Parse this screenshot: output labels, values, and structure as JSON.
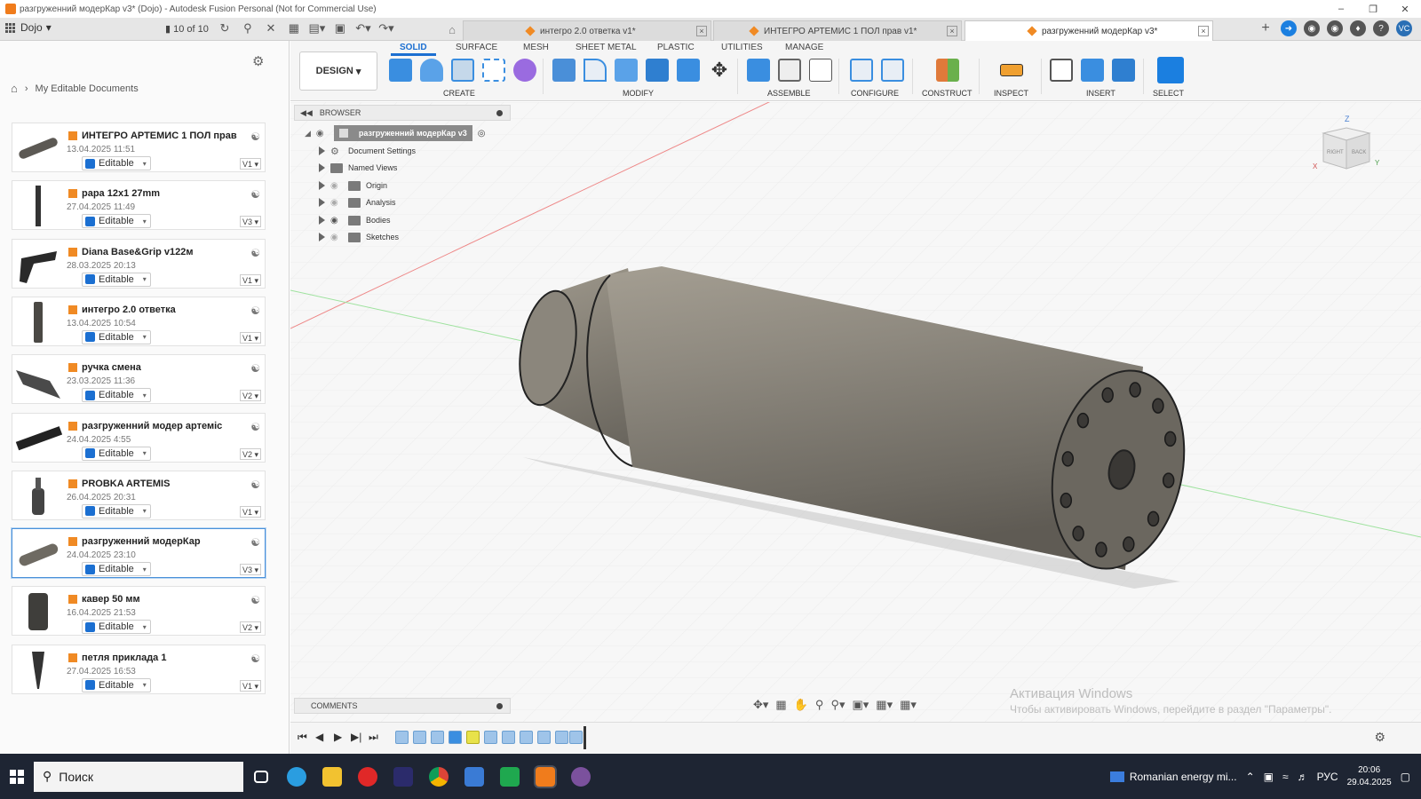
{
  "window": {
    "title": "разгруженний модерКар v3* (Dojo) - Autodesk Fusion Personal (Not for Commercial Use)"
  },
  "topbar": {
    "team": "Dojo",
    "doc_count": "10 of 10",
    "tabs": [
      {
        "label": "интегро 2.0 ответка v1*",
        "active": false
      },
      {
        "label": "ИНТЕГРО АРТЕМИС 1 ПОЛ прав v1*",
        "active": false
      },
      {
        "label": "разгруженний модерКар v3*",
        "active": true
      }
    ],
    "avatar": "VC"
  },
  "datapanel": {
    "breadcrumb": "My Editable Documents",
    "docs": [
      {
        "name": "ИНТЕГРО АРТЕМИС 1 ПОЛ прав",
        "date": "13.04.2025 11:51",
        "status": "Editable",
        "version": "V1"
      },
      {
        "name": "рара 12х1 27mm",
        "date": "27.04.2025 11:49",
        "status": "Editable",
        "version": "V3"
      },
      {
        "name": "Diana Base&Grip v122м",
        "date": "28.03.2025 20:13",
        "status": "Editable",
        "version": "V1"
      },
      {
        "name": "интегро 2.0 ответка",
        "date": "13.04.2025 10:54",
        "status": "Editable",
        "version": "V1"
      },
      {
        "name": "ручка смена",
        "date": "23.03.2025 11:36",
        "status": "Editable",
        "version": "V2"
      },
      {
        "name": "разгруженний модер артеміс",
        "date": "24.04.2025 4:55",
        "status": "Editable",
        "version": "V2"
      },
      {
        "name": "PROBKA ARTEMIS",
        "date": "26.04.2025 20:31",
        "status": "Editable",
        "version": "V1"
      },
      {
        "name": "разгруженний модерКар",
        "date": "24.04.2025 23:10",
        "status": "Editable",
        "version": "V3"
      },
      {
        "name": "кавер 50 мм",
        "date": "16.04.2025 21:53",
        "status": "Editable",
        "version": "V2"
      },
      {
        "name": "петля приклада 1",
        "date": "27.04.2025 16:53",
        "status": "Editable",
        "version": "V1"
      }
    ]
  },
  "toolbar": {
    "workspace": "DESIGN",
    "tabs": [
      "SOLID",
      "SURFACE",
      "MESH",
      "SHEET METAL",
      "PLASTIC",
      "UTILITIES",
      "MANAGE"
    ],
    "groups": [
      "CREATE",
      "MODIFY",
      "ASSEMBLE",
      "CONFIGURE",
      "CONSTRUCT",
      "INSPECT",
      "INSERT",
      "SELECT"
    ]
  },
  "browser": {
    "title": "BROWSER",
    "root": "разгруженний модерКар v3",
    "items": [
      "Document Settings",
      "Named Views",
      "Origin",
      "Analysis",
      "Bodies",
      "Sketches"
    ]
  },
  "comments": {
    "title": "COMMENTS"
  },
  "watermark": {
    "line1": "Активация Windows",
    "line2": "Чтобы активировать Windows, перейдите в раздел \"Параметры\"."
  },
  "taskbar": {
    "search": "Поиск",
    "news": "Romanian energy mi...",
    "lang": "РУС",
    "time": "20:06",
    "date": "29.04.2025"
  },
  "colors": {
    "accent": "#1b6fd1",
    "doc_icon": "#f08a24",
    "body": "#8a857c"
  }
}
